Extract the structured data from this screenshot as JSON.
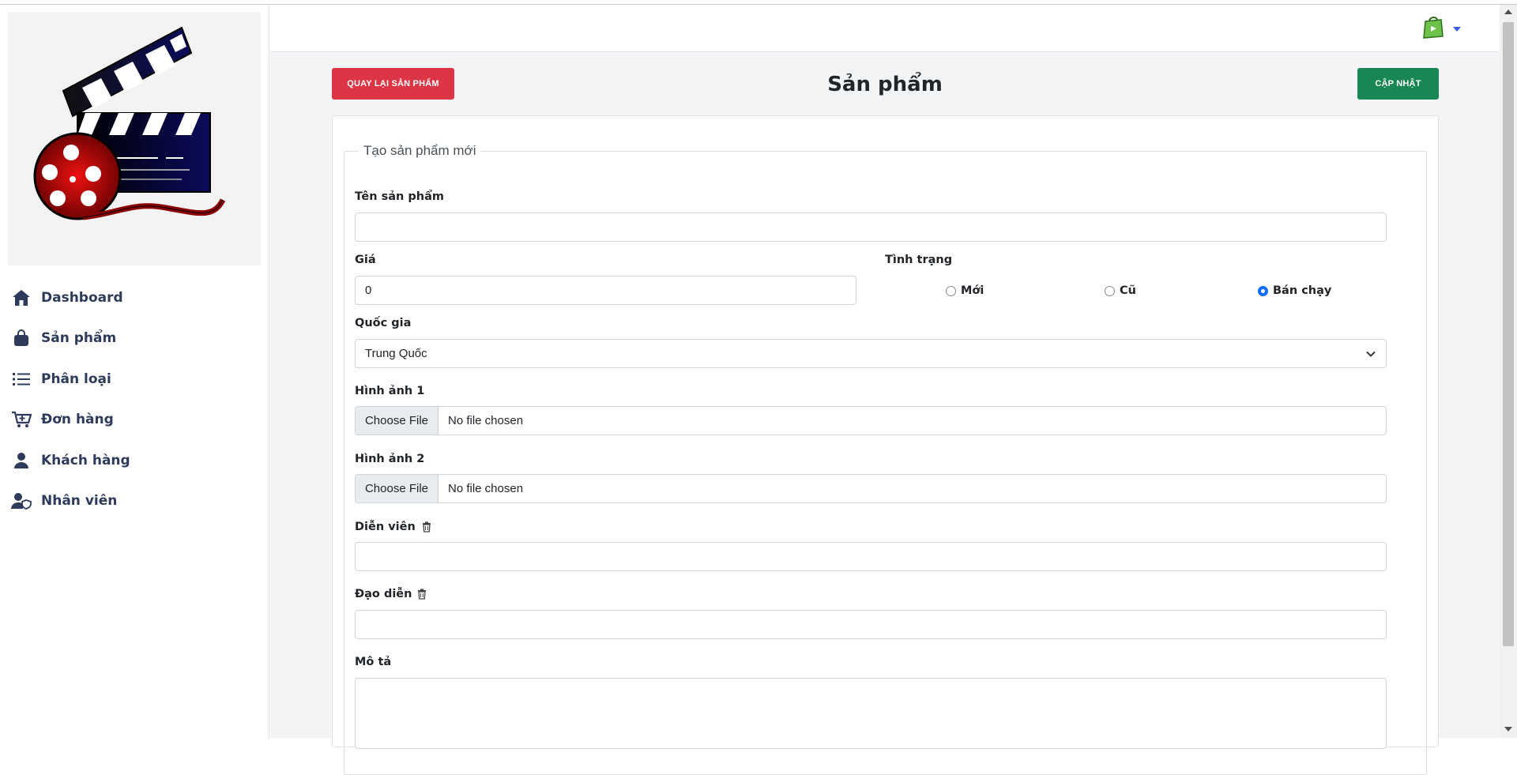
{
  "sidebar": {
    "items": [
      {
        "label": "Dashboard",
        "icon": "home-icon"
      },
      {
        "label": "Sản phẩm",
        "icon": "shopping-bag-icon"
      },
      {
        "label": "Phân loại",
        "icon": "list-icon"
      },
      {
        "label": "Đơn hàng",
        "icon": "cart-plus-icon"
      },
      {
        "label": "Khách hàng",
        "icon": "user-icon"
      },
      {
        "label": "Nhân viên",
        "icon": "user-shield-icon"
      }
    ],
    "logo_colors": {
      "dark": "#1a1a2e",
      "navy": "#0b0b5c",
      "red": "#b31212"
    }
  },
  "header": {
    "user_icon": "shopping-bag-avatar-icon",
    "caret_icon": "caret-down-icon"
  },
  "toolbar": {
    "back_label": "QUAY LẠI SẢN PHẨM",
    "title": "Sản phẩm",
    "update_label": "CẬP NHẬT"
  },
  "form": {
    "legend": "Tạo sản phẩm mới",
    "name": {
      "label": "Tên sản phẩm",
      "value": ""
    },
    "price": {
      "label": "Giá",
      "value": "0"
    },
    "status": {
      "label": "Tình trạng",
      "options": [
        "Mới",
        "Cũ",
        "Bán chạy"
      ],
      "selected": "Bán chạy"
    },
    "country": {
      "label": "Quốc gia",
      "value": "Trung Quốc"
    },
    "image1": {
      "label": "Hình ảnh 1",
      "button": "Choose File",
      "status": "No file chosen"
    },
    "image2": {
      "label": "Hình ảnh 2",
      "button": "Choose File",
      "status": "No file chosen"
    },
    "actors": {
      "label": "Diễn viên",
      "value": ""
    },
    "director": {
      "label": "Đạo diễn",
      "value": ""
    },
    "description": {
      "label": "Mô tả",
      "value": ""
    }
  },
  "colors": {
    "danger": "#dc3545",
    "success": "#198754",
    "nav_text": "#2e3b5b",
    "radio_active": "#0d6efd"
  }
}
